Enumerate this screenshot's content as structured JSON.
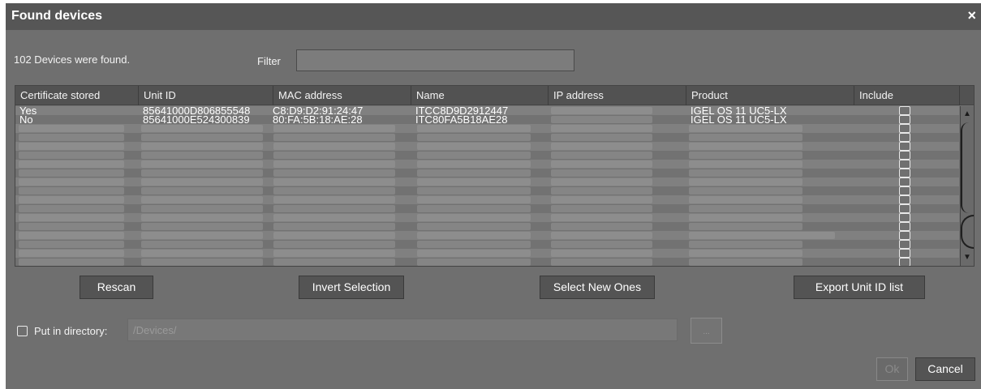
{
  "dialog": {
    "title": "Found devices",
    "close_glyph": "×"
  },
  "summary": {
    "found_text": "102 Devices were found.",
    "filter_label": "Filter",
    "filter_value": ""
  },
  "table": {
    "headers": [
      "Certificate stored",
      "Unit ID",
      "MAC address",
      "Name",
      "IP address",
      "Product",
      "Include"
    ],
    "rows": [
      {
        "cert": "Yes",
        "unit_id": "85641000D806855548",
        "mac": "C8:D9:D2:91:24:47",
        "name": "ITCC8D9D2912447",
        "ip": "",
        "product": "IGEL OS 11 UC5-LX"
      },
      {
        "cert": "No",
        "unit_id": "85641000E524300839",
        "mac": "80:FA:5B:18:AE:28",
        "name": "ITC80FA5B18AE28",
        "ip": "",
        "product": "IGEL OS 11 UC5-LX"
      }
    ],
    "scroll_up_glyph": "▲",
    "scroll_down_glyph": "▼"
  },
  "buttons": {
    "rescan": "Rescan",
    "invert": "Invert Selection",
    "select_new": "Select New Ones",
    "export": "Export Unit ID list",
    "browse": "...",
    "ok": "Ok",
    "cancel": "Cancel"
  },
  "directory": {
    "label": "Put in directory:",
    "value": "/Devices/"
  }
}
